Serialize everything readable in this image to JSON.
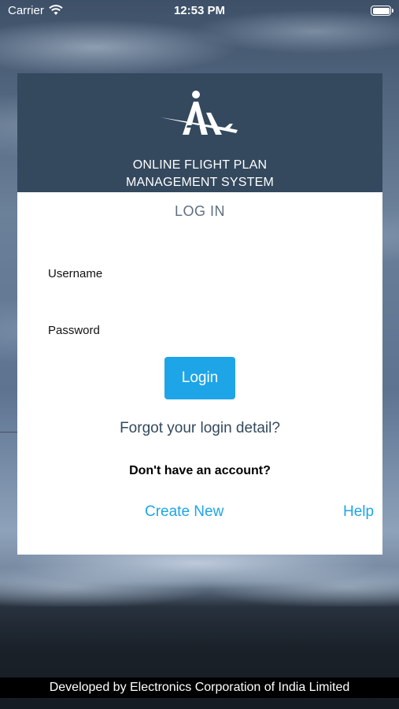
{
  "status_bar": {
    "carrier": "Carrier",
    "time": "12:53 PM"
  },
  "header": {
    "title_line1": "ONLINE FLIGHT PLAN",
    "title_line2": "MANAGEMENT SYSTEM",
    "logo_icon": "aai-logo-icon"
  },
  "form": {
    "heading": "LOG IN",
    "username_label": "Username",
    "username_value": "",
    "password_label": "Password",
    "password_value": "",
    "login_button": "Login",
    "forgot_link": "Forgot your login detail?",
    "no_account_text": "Don't have an account?",
    "create_link": "Create New",
    "help_link": "Help"
  },
  "footer": {
    "text": "Developed by Electronics Corporation of India Limited"
  },
  "colors": {
    "header_bg": "#34495e",
    "accent": "#1ea5e8",
    "link_dark": "#34495e"
  }
}
